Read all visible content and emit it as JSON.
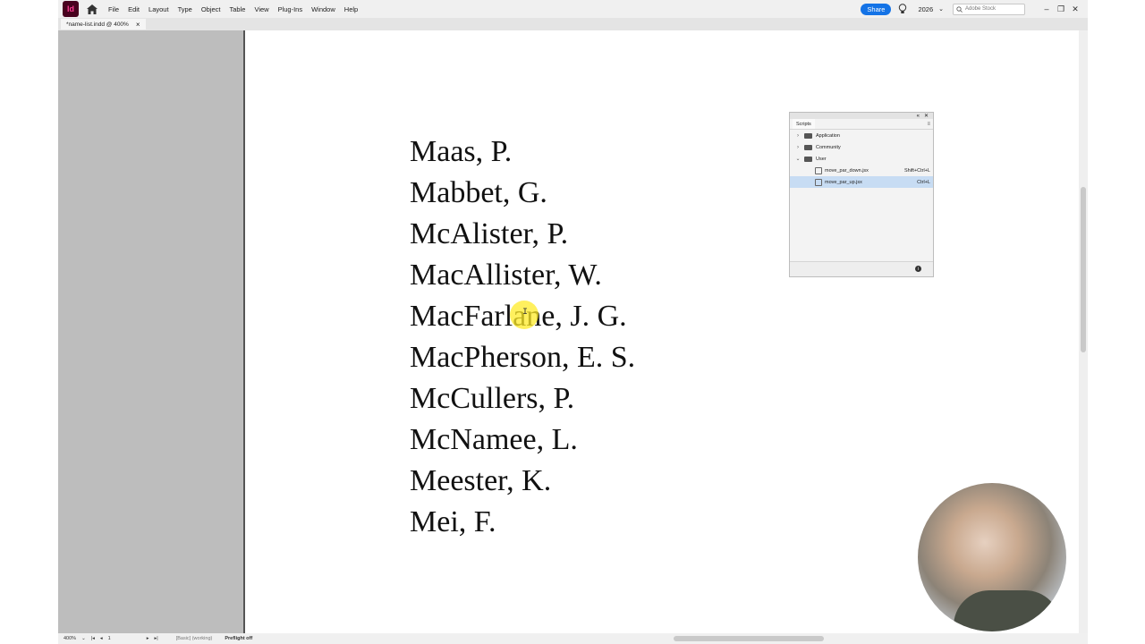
{
  "menubar": {
    "app_icon_text": "Id",
    "menus": [
      "File",
      "Edit",
      "Layout",
      "Type",
      "Object",
      "Table",
      "View",
      "Plug-Ins",
      "Window",
      "Help"
    ],
    "share_label": "Share",
    "workspace": "2026",
    "stock_placeholder": "Adobe Stock"
  },
  "document": {
    "tab_title": "*name-list.indd @ 400%",
    "names": [
      "Maas, P.",
      "Mabbet, G.",
      "McAlister, P.",
      "MacAllister, W.",
      "MacFarlane, J. G.",
      "MacPherson, E. S.",
      "McCullers, P.",
      "McNamee, L.",
      "Meester, K.",
      "Mei, F."
    ]
  },
  "scripts_panel": {
    "title": "Scripts",
    "folders": [
      "Application",
      "Community",
      "User"
    ],
    "scripts": [
      {
        "name": "move_par_down.jsx",
        "shortcut": "Shift+Ctrl+L"
      },
      {
        "name": "move_par_up.jsx",
        "shortcut": "Ctrl+L"
      }
    ]
  },
  "statusbar": {
    "zoom": "400%",
    "page": "1",
    "profile": "[Basic] (working)",
    "preflight": "Preflight off"
  }
}
